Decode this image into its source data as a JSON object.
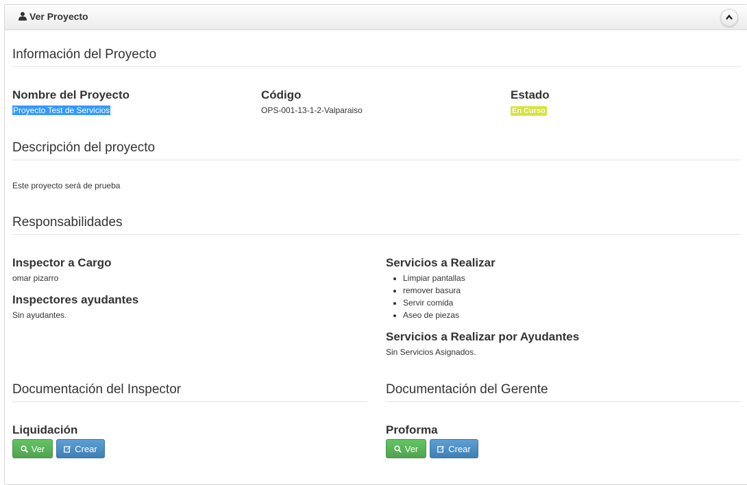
{
  "panel": {
    "title": "Ver Proyecto",
    "title_icon": "user-icon",
    "collapse_icon": "chevron-up-icon"
  },
  "info": {
    "heading": "Información del Proyecto",
    "name_label": "Nombre del Proyecto",
    "name_value": "Proyecto Test de Servicios",
    "code_label": "Código",
    "code_value": "OPS-001-13-1-2-Valparaiso",
    "status_label": "Estado",
    "status_value": "En Curso",
    "status_color": "#d8e43a"
  },
  "description": {
    "heading": "Descripción del proyecto",
    "text": "Este proyecto será de prueba"
  },
  "responsibilities": {
    "heading": "Responsabilidades",
    "inspector_label": "Inspector a Cargo",
    "inspector_value": "omar pizarro",
    "helpers_label": "Inspectores ayudantes",
    "helpers_value": "Sin ayudantes.",
    "services_label": "Servicios a Realizar",
    "services": [
      "Limpiar pantallas",
      "remover basura",
      "Servir comida",
      "Aseo de piezas"
    ],
    "helper_services_label": "Servicios a Realizar por Ayudantes",
    "helper_services_value": "Sin Servicios Asignados."
  },
  "inspector_docs": {
    "heading": "Documentación del Inspector",
    "item_label": "Liquidación",
    "view_label": "Ver",
    "create_label": "Crear"
  },
  "manager_docs": {
    "heading": "Documentación del Gerente",
    "item_label": "Proforma",
    "view_label": "Ver",
    "create_label": "Crear"
  },
  "colors": {
    "button_green": "#5bb75b",
    "button_blue": "#4a8bc2",
    "selection": "#3399ff"
  }
}
